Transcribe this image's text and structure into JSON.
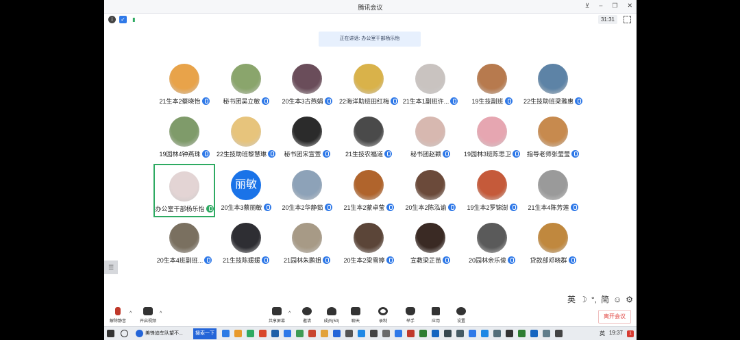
{
  "window": {
    "title": "腾讯会议",
    "timer": "31:31"
  },
  "speaking": "正在讲话: 办公室干部杨乐怡",
  "participants": [
    {
      "name": "21生本2蔡晓怡",
      "color": "#e8a34a"
    },
    {
      "name": "秘书团吴立敏",
      "color": "#8aa56c"
    },
    {
      "name": "20生本3古燕娟",
      "color": "#6a4d5a"
    },
    {
      "name": "22海洋助班田红梅",
      "color": "#d9b24a"
    },
    {
      "name": "21生本1副班许...",
      "color": "#c9c3c0"
    },
    {
      "name": "19生技副班",
      "color": "#b77a4e"
    },
    {
      "name": "22生技助班梁雅惠",
      "color": "#5d83a6"
    },
    {
      "name": "19园林4钟燕珠",
      "color": "#7f9b6a"
    },
    {
      "name": "22生技助班黎慧琳",
      "color": "#e7c47c"
    },
    {
      "name": "秘书团宋宣萱",
      "color": "#2b2b2b"
    },
    {
      "name": "21生技农福道",
      "color": "#4a4a4a"
    },
    {
      "name": "秘书团赵颖",
      "color": "#d7b8b0"
    },
    {
      "name": "19园林3班陈思卫",
      "color": "#e6a6b1"
    },
    {
      "name": "指导老师张莹莹",
      "color": "#c78a4e"
    },
    {
      "name": "办公室干部杨乐怡",
      "color": "#e3d4d4",
      "active": true
    },
    {
      "name": "20生本3蔡丽敏",
      "color": "#1a73e8",
      "text": "丽敏"
    },
    {
      "name": "20生本2华静茹",
      "color": "#8da2b8"
    },
    {
      "name": "21生本2蒙卓莹",
      "color": "#b0642c"
    },
    {
      "name": "20生本2陈泓谕",
      "color": "#6b4a3a"
    },
    {
      "name": "19生本2罗锦澍",
      "color": "#c55a3a"
    },
    {
      "name": "21生本4陈芳莲",
      "color": "#9a9a9a"
    },
    {
      "name": "20生本4班副班...",
      "color": "#7a7060"
    },
    {
      "name": "21生技陈媛媛",
      "color": "#2e2e33"
    },
    {
      "name": "21园林朱鹏姐",
      "color": "#a79a86"
    },
    {
      "name": "20生本2梁雪婷",
      "color": "#5b4538"
    },
    {
      "name": "宣教梁芷苗",
      "color": "#3a2a24"
    },
    {
      "name": "20园林余乐俊",
      "color": "#5a5a5a"
    },
    {
      "name": "贷款部邓晓群",
      "color": "#c0883e"
    }
  ],
  "toolbar": {
    "unmute": "解除静音",
    "video": "开启视频",
    "share": "共享屏幕",
    "invite": "邀请",
    "members": "成员(50)",
    "chat": "聊天",
    "record": "录制",
    "hand": "举手",
    "apps": "应用",
    "settings": "设置",
    "leave": "离开会议"
  },
  "ime": {
    "lang": "英",
    "mode": "简"
  },
  "taskbar": {
    "app1": "美锋迪车队望不...",
    "search": "搜索一下",
    "time": "19:37",
    "lang": "英",
    "notif": "1"
  }
}
